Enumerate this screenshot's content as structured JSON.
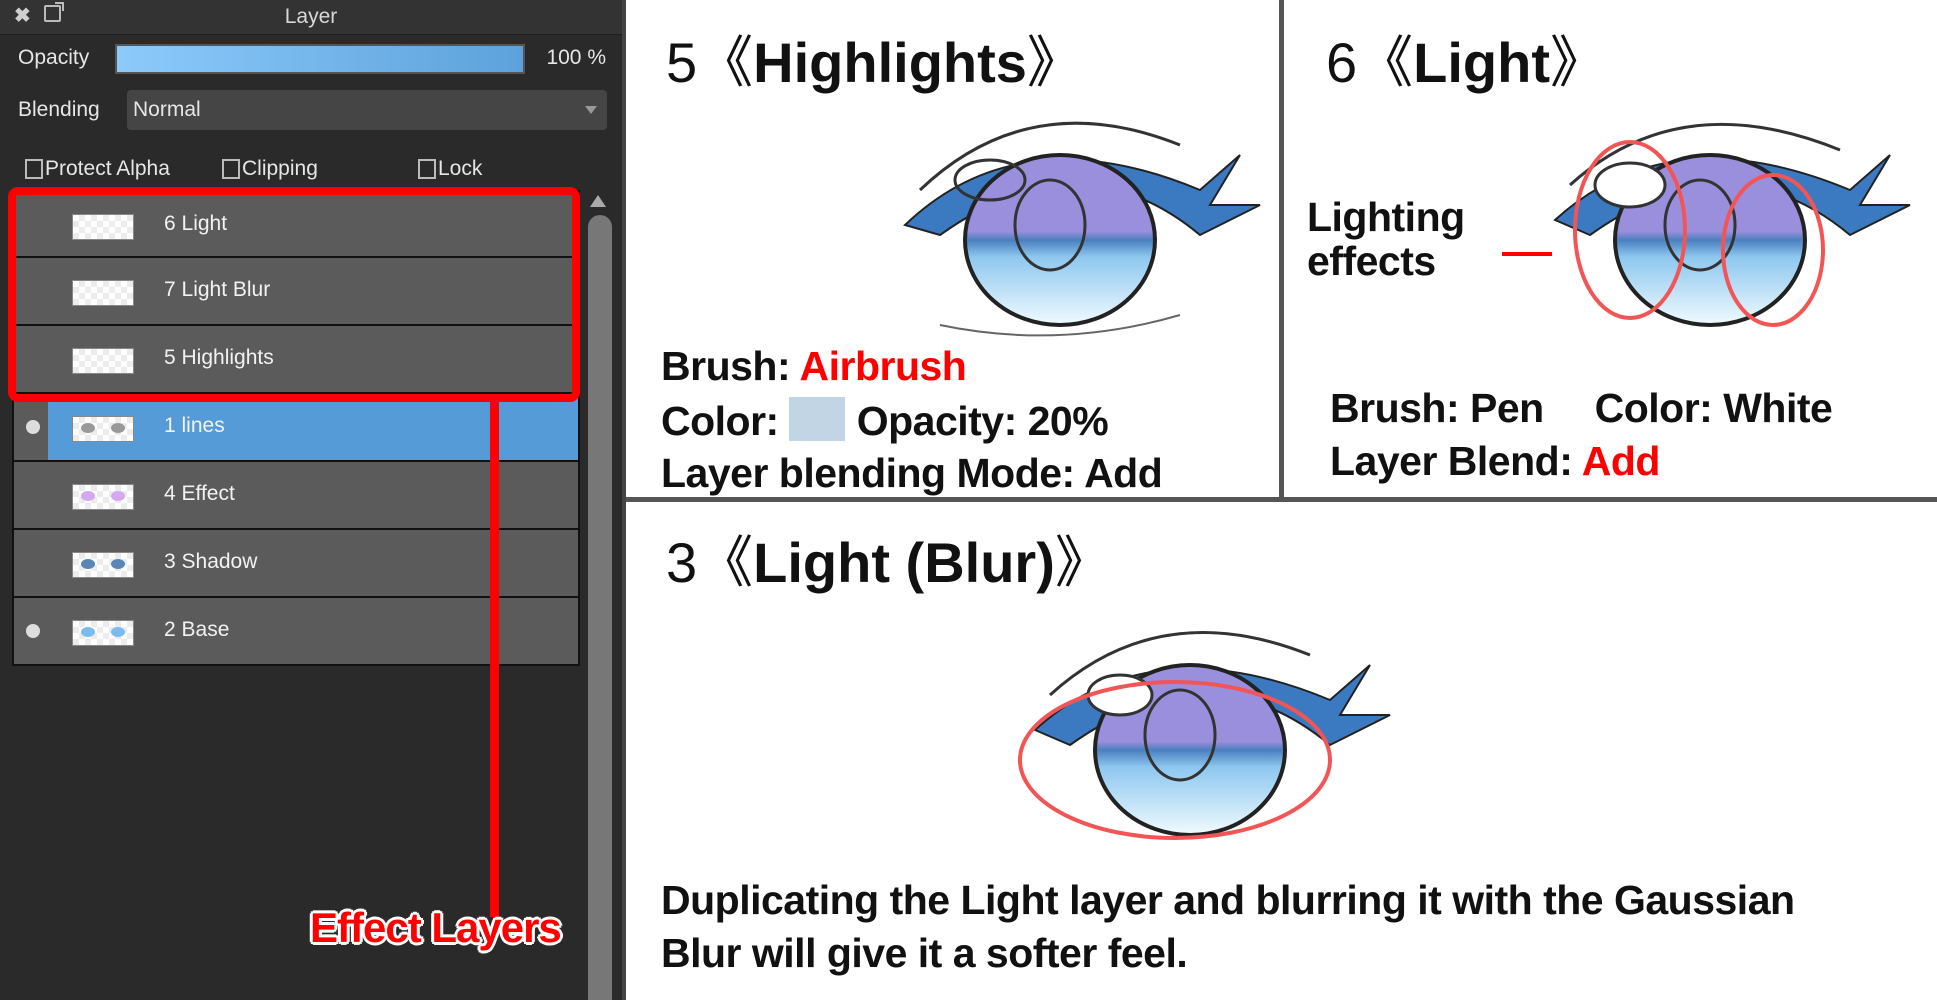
{
  "panel": {
    "title": "Layer",
    "opacity_label": "Opacity",
    "opacity_value": "100 %",
    "opacity_percent": 100,
    "blending_label": "Blending",
    "blending_value": "Normal",
    "checkboxes": [
      {
        "label": "Protect Alpha",
        "checked": false
      },
      {
        "label": "Clipping",
        "checked": false
      },
      {
        "label": "Lock",
        "checked": false
      }
    ],
    "layers": [
      {
        "name": "6 Light",
        "visible": false,
        "selected": false,
        "thumb": "empty"
      },
      {
        "name": "7 Light Blur",
        "visible": false,
        "selected": false,
        "thumb": "empty"
      },
      {
        "name": "5 Highlights",
        "visible": false,
        "selected": false,
        "thumb": "empty"
      },
      {
        "name": "1 lines",
        "visible": true,
        "selected": true,
        "thumb": "lines"
      },
      {
        "name": "4  Effect",
        "visible": false,
        "selected": false,
        "thumb": "effect"
      },
      {
        "name": "3 Shadow",
        "visible": false,
        "selected": false,
        "thumb": "shadow"
      },
      {
        "name": "2 Base",
        "visible": true,
        "selected": false,
        "thumb": "base"
      }
    ],
    "annotation_label": "Effect Layers"
  },
  "sections": {
    "highlights": {
      "number": "5",
      "title": "Highlights",
      "brush_label": "Brush:",
      "brush_value": "Airbrush",
      "color_label": "Color:",
      "color_swatch": "#c1d5e5",
      "opacity_text": "Opacity: 20%",
      "blend_text": "Layer blending Mode: Add"
    },
    "light": {
      "number": "6",
      "title": "Light",
      "callout": [
        "Lighting",
        "effects"
      ],
      "brush_text": "Brush: Pen",
      "color_text": "Color: White",
      "blend_label": "Layer Blend:",
      "blend_value": "Add"
    },
    "light_blur": {
      "number": "3",
      "title": "Light (Blur)",
      "description_line1": "Duplicating the Light layer and blurring it with the Gaussian",
      "description_line2": "Blur will give it a softer feel."
    }
  },
  "colors": {
    "accent_red": "#ff0000",
    "selected_layer": "#559bd8",
    "panel_bg": "#2a2a2a"
  }
}
